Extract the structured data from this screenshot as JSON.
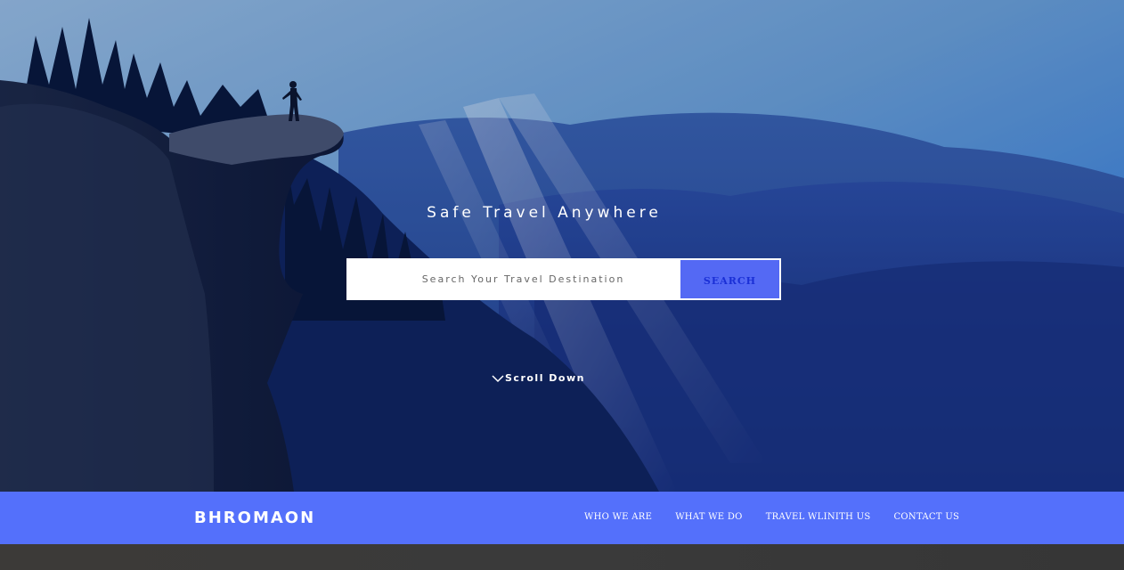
{
  "hero": {
    "tagline": "Safe Travel Anywhere",
    "scroll_label": "Scroll Down"
  },
  "search": {
    "placeholder": "Search Your Travel Destination",
    "button_label": "SEARCH",
    "icon": "search-icon"
  },
  "navbar": {
    "brand": "BHROMAON",
    "items": [
      {
        "label": "WHO WE ARE"
      },
      {
        "label": "WHAT WE DO"
      },
      {
        "label": "TRAVEL WLINITH US"
      },
      {
        "label": "CONTACT US"
      }
    ]
  },
  "colors": {
    "accent": "#5470fb",
    "search_button": "#5469f4",
    "search_label": "#1a2fd6"
  }
}
